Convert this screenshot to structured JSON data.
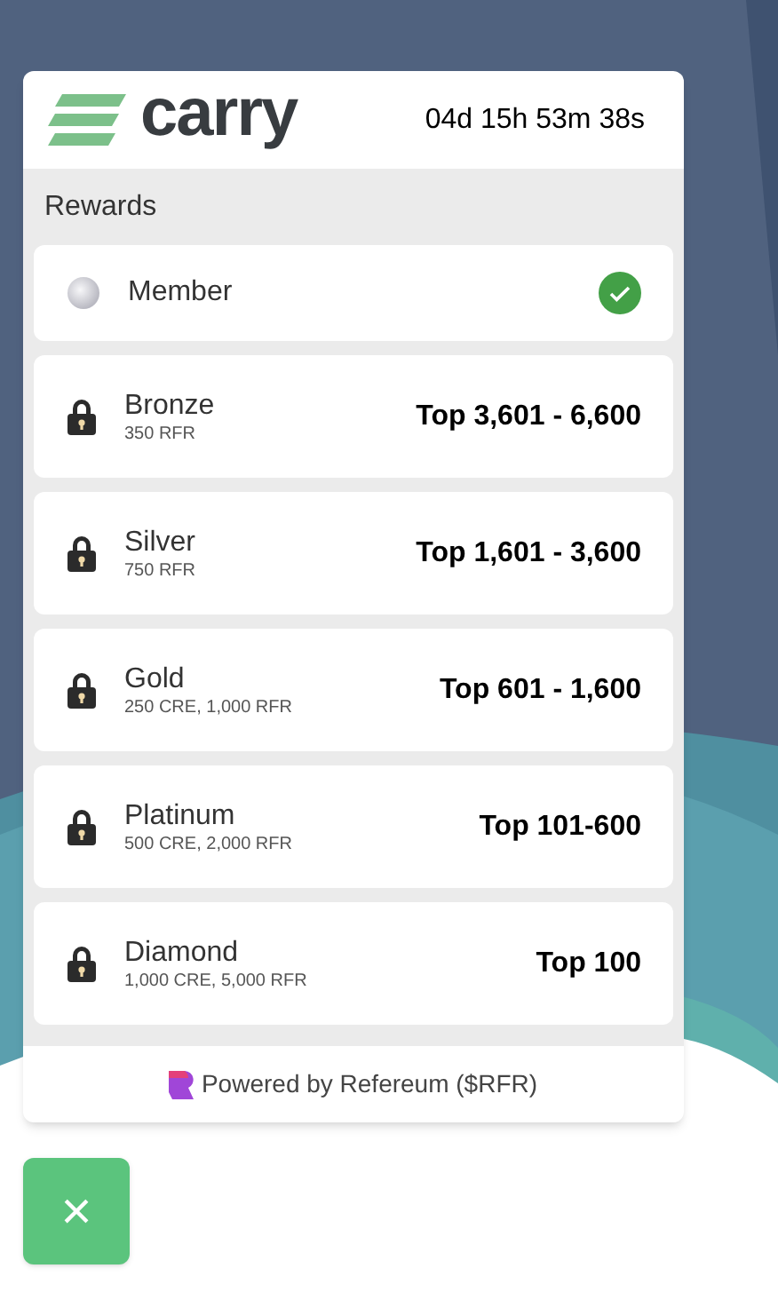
{
  "header": {
    "logo": "carry",
    "countdown": "04d 15h 53m 38s"
  },
  "section": {
    "title": "Rewards"
  },
  "tiers": [
    {
      "name": "Member",
      "unlocked": true
    },
    {
      "name": "Bronze",
      "requirement": "350 RFR",
      "rank": "Top 3,601 - 6,600",
      "unlocked": false
    },
    {
      "name": "Silver",
      "requirement": "750 RFR",
      "rank": "Top 1,601 - 3,600",
      "unlocked": false
    },
    {
      "name": "Gold",
      "requirement": "250 CRE, 1,000 RFR",
      "rank": "Top 601 - 1,600",
      "unlocked": false
    },
    {
      "name": "Platinum",
      "requirement": "500 CRE, 2,000 RFR",
      "rank": "Top 101-600",
      "unlocked": false
    },
    {
      "name": "Diamond",
      "requirement": "1,000 CRE, 5,000 RFR",
      "rank": "Top 100",
      "unlocked": false
    }
  ],
  "footer": {
    "text": "Powered by Refereum ($RFR)"
  },
  "close_button": {
    "label": "×"
  }
}
